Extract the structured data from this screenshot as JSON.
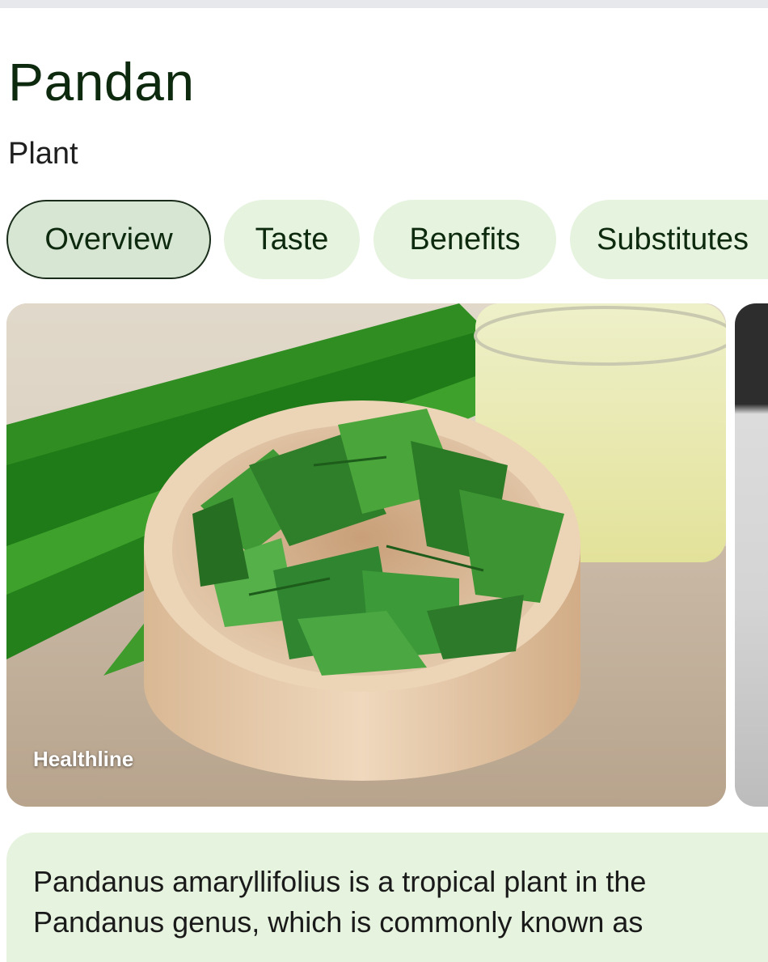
{
  "entity": {
    "title": "Pandan",
    "subtitle": "Plant"
  },
  "tabs": [
    {
      "label": "Overview",
      "selected": true
    },
    {
      "label": "Taste",
      "selected": false
    },
    {
      "label": "Benefits",
      "selected": false
    },
    {
      "label": "Substitutes",
      "selected": false
    }
  ],
  "gallery": {
    "images": [
      {
        "source": "Healthline",
        "subject": "Chopped pandan leaves in a wooden bowl with a glass of pandan drink"
      }
    ]
  },
  "description": {
    "text": "Pandanus amaryllifolius is a tropical plant in the Pandanus genus, which is commonly known as"
  },
  "colors": {
    "title": "#0d2a0f",
    "chip_bg": "#e6f3df",
    "chip_active_bg": "#d6e6d3",
    "card_bg": "#e6f3df"
  },
  "icons": [
    "pandan-leaf-photo"
  ]
}
